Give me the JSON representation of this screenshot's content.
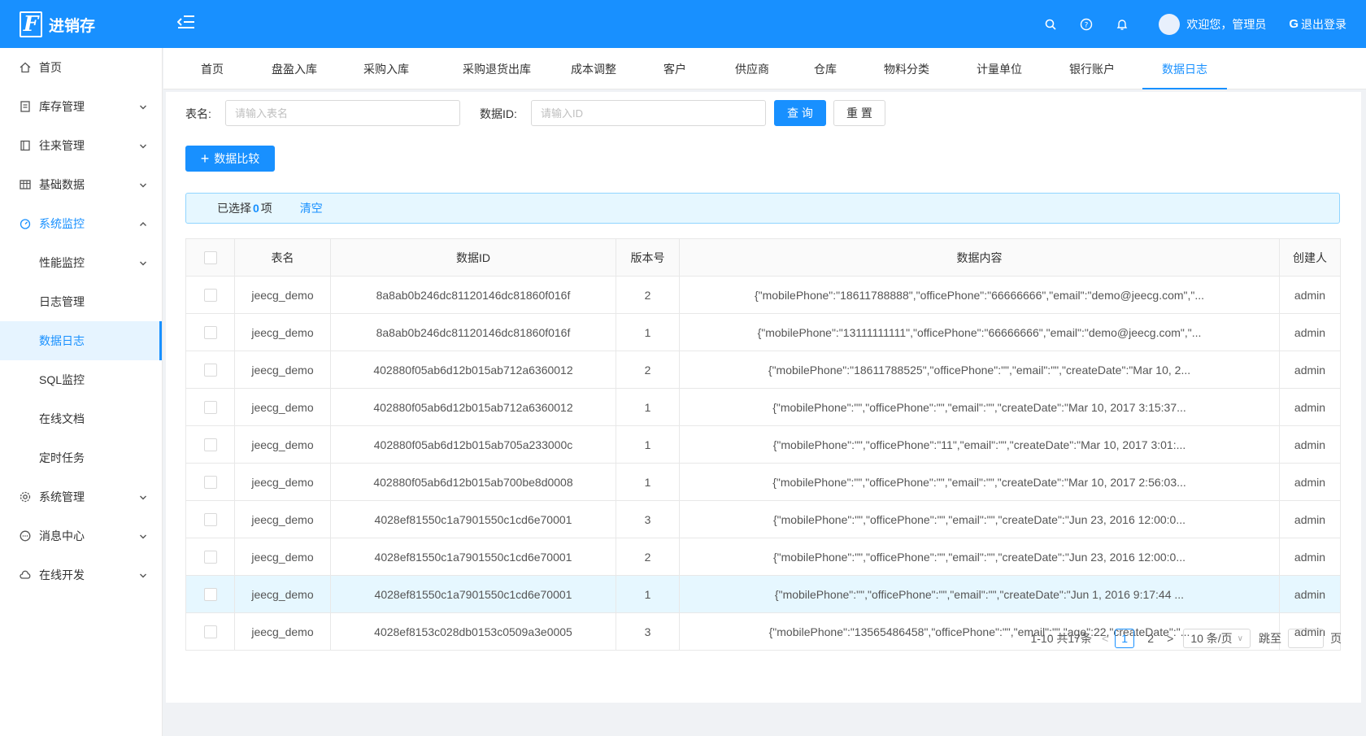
{
  "app": {
    "logo_letter": "F",
    "title": "进销存"
  },
  "header": {
    "welcome": "欢迎您，管理员",
    "logout": "退出登录",
    "logout_glyph": "G"
  },
  "sidebar": {
    "items": [
      {
        "label": "首页",
        "icon": "home-icon"
      },
      {
        "label": "库存管理",
        "icon": "file-icon"
      },
      {
        "label": "往来管理",
        "icon": "book-icon"
      },
      {
        "label": "基础数据",
        "icon": "table-icon"
      },
      {
        "label": "系统监控",
        "icon": "dashboard-icon"
      }
    ],
    "sub_items": [
      "性能监控",
      "日志管理",
      "数据日志",
      "SQL监控",
      "在线文档",
      "定时任务"
    ],
    "bottom_items": [
      {
        "label": "系统管理",
        "icon": "gear-icon"
      },
      {
        "label": "消息中心",
        "icon": "message-icon"
      },
      {
        "label": "在线开发",
        "icon": "cloud-icon"
      }
    ]
  },
  "tabs": [
    "首页",
    "盘盈入库",
    "采购入库",
    "采购退货出库",
    "成本调整",
    "客户",
    "供应商",
    "仓库",
    "物料分类",
    "计量单位",
    "银行账户",
    "数据日志"
  ],
  "search": {
    "table_label": "表名:",
    "table_placeholder": "请输入表名",
    "id_label": "数据ID:",
    "id_placeholder": "请输入ID",
    "query": "查 询",
    "reset": "重 置",
    "compare": "数据比较",
    "compare_icon": "+"
  },
  "selection": {
    "prefix": "已选择",
    "count": "0",
    "suffix": "项",
    "clear": "清空"
  },
  "table": {
    "columns": [
      "表名",
      "数据ID",
      "版本号",
      "数据内容",
      "创建人"
    ],
    "rows": [
      [
        "jeecg_demo",
        "8a8ab0b246dc81120146dc81860f016f",
        "2",
        "{\"mobilePhone\":\"18611788888\",\"officePhone\":\"66666666\",\"email\":\"demo@jeecg.com\",\"...",
        "admin"
      ],
      [
        "jeecg_demo",
        "8a8ab0b246dc81120146dc81860f016f",
        "1",
        "{\"mobilePhone\":\"13111111111\",\"officePhone\":\"66666666\",\"email\":\"demo@jeecg.com\",\"...",
        "admin"
      ],
      [
        "jeecg_demo",
        "402880f05ab6d12b015ab712a6360012",
        "2",
        "{\"mobilePhone\":\"18611788525\",\"officePhone\":\"\",\"email\":\"\",\"createDate\":\"Mar 10, 2...",
        "admin"
      ],
      [
        "jeecg_demo",
        "402880f05ab6d12b015ab712a6360012",
        "1",
        "{\"mobilePhone\":\"\",\"officePhone\":\"\",\"email\":\"\",\"createDate\":\"Mar 10, 2017 3:15:37...",
        "admin"
      ],
      [
        "jeecg_demo",
        "402880f05ab6d12b015ab705a233000c",
        "1",
        "{\"mobilePhone\":\"\",\"officePhone\":\"11\",\"email\":\"\",\"createDate\":\"Mar 10, 2017 3:01:...",
        "admin"
      ],
      [
        "jeecg_demo",
        "402880f05ab6d12b015ab700be8d0008",
        "1",
        "{\"mobilePhone\":\"\",\"officePhone\":\"\",\"email\":\"\",\"createDate\":\"Mar 10, 2017 2:56:03...",
        "admin"
      ],
      [
        "jeecg_demo",
        "4028ef81550c1a7901550c1cd6e70001",
        "3",
        "{\"mobilePhone\":\"\",\"officePhone\":\"\",\"email\":\"\",\"createDate\":\"Jun 23, 2016 12:00:0...",
        "admin"
      ],
      [
        "jeecg_demo",
        "4028ef81550c1a7901550c1cd6e70001",
        "2",
        "{\"mobilePhone\":\"\",\"officePhone\":\"\",\"email\":\"\",\"createDate\":\"Jun 23, 2016 12:00:0...",
        "admin"
      ],
      [
        "jeecg_demo",
        "4028ef81550c1a7901550c1cd6e70001",
        "1",
        "{\"mobilePhone\":\"\",\"officePhone\":\"\",\"email\":\"\",\"createDate\":\"Jun 1, 2016 9:17:44 ...",
        "admin"
      ],
      [
        "jeecg_demo",
        "4028ef8153c028db0153c0509a3e0005",
        "3",
        "{\"mobilePhone\":\"13565486458\",\"officePhone\":\"\",\"email\":\"\",\"age\":22,\"createDate\":\"...",
        "admin"
      ]
    ]
  },
  "pagination": {
    "total": "1-10 共17条",
    "pages": [
      "1",
      "2"
    ],
    "prev": "<",
    "next": ">",
    "page_size": "10 条/页",
    "dropdown_glyph": "∨",
    "jump_label": "跳至",
    "page_suffix": "页"
  },
  "colors": {
    "primary": "#1890ff",
    "highlight_row": "#e6f7ff"
  }
}
